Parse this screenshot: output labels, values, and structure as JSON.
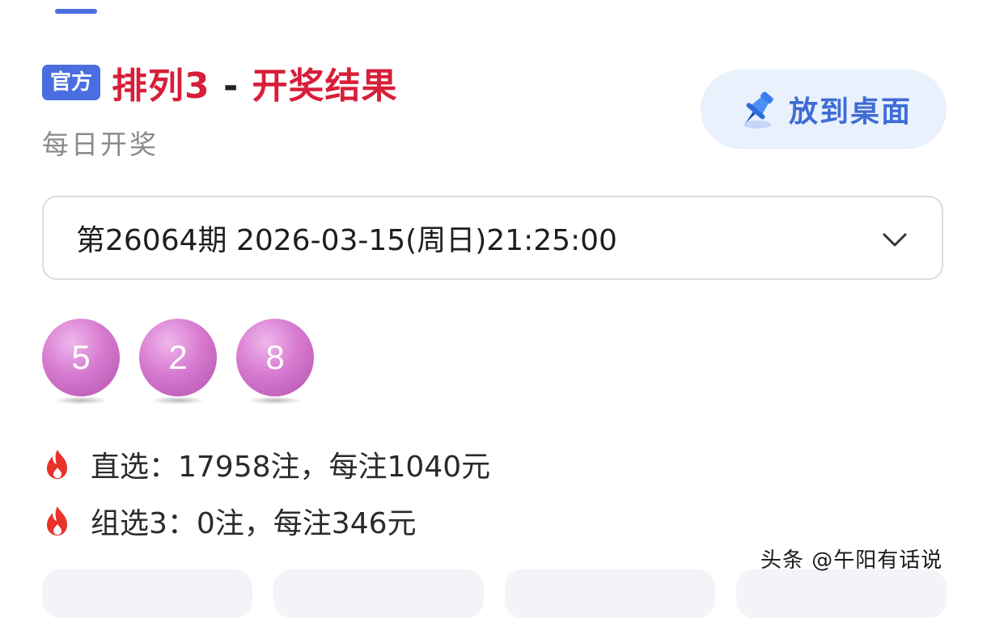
{
  "header": {
    "badge": "官方",
    "title_game": "排列3",
    "title_sep": " - ",
    "title_result": "开奖结果",
    "subtitle": "每日开奖"
  },
  "pin_button": {
    "label": "放到桌面",
    "icon": "pushpin-icon"
  },
  "issue_select": {
    "value": "第26064期 2026-03-15(周日)21:25:00",
    "icon": "chevron-down-icon"
  },
  "balls": [
    "5",
    "2",
    "8"
  ],
  "prizes": [
    {
      "icon": "fire-icon",
      "text": "直选：17958注，每注1040元"
    },
    {
      "icon": "fire-icon",
      "text": "组选3：0注，每注346元"
    }
  ],
  "watermark": "头条 @午阳有话说",
  "colors": {
    "accent_blue": "#4a6ee0",
    "title_red": "#d81e3a",
    "ball_purple": "#d77ad0",
    "fire_red": "#e8322a"
  }
}
